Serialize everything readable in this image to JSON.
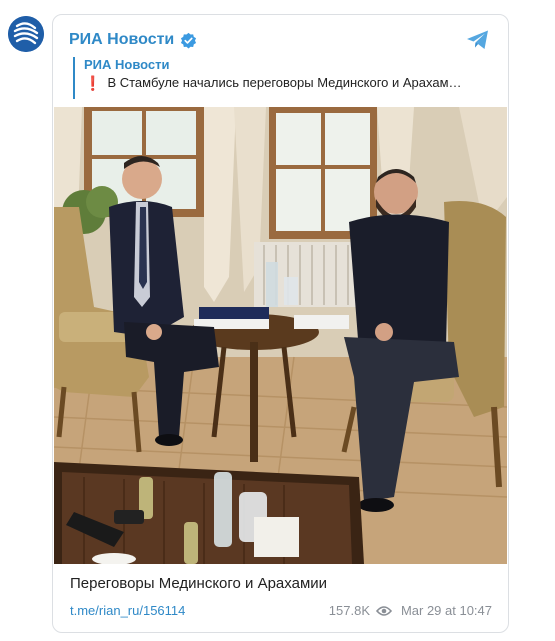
{
  "channel": {
    "name": "РИА Новости",
    "verified": true,
    "avatar_icon": "ria-logo-icon",
    "platform_icon": "telegram-icon"
  },
  "reply": {
    "author": "РИА Новости",
    "marker": "❗",
    "text": "В Стамбуле начались переговоры Мединского и Арахам…"
  },
  "photo": {
    "icon": "photo"
  },
  "post": {
    "caption": "Переговоры Мединского и Арахамии",
    "link": "t.me/rian_ru/156114",
    "views": "157.8K",
    "date": "Mar 29 at 10:47"
  },
  "colors": {
    "accent": "#2f89c7",
    "alert": "#e2252b",
    "muted": "#8a8f96"
  }
}
